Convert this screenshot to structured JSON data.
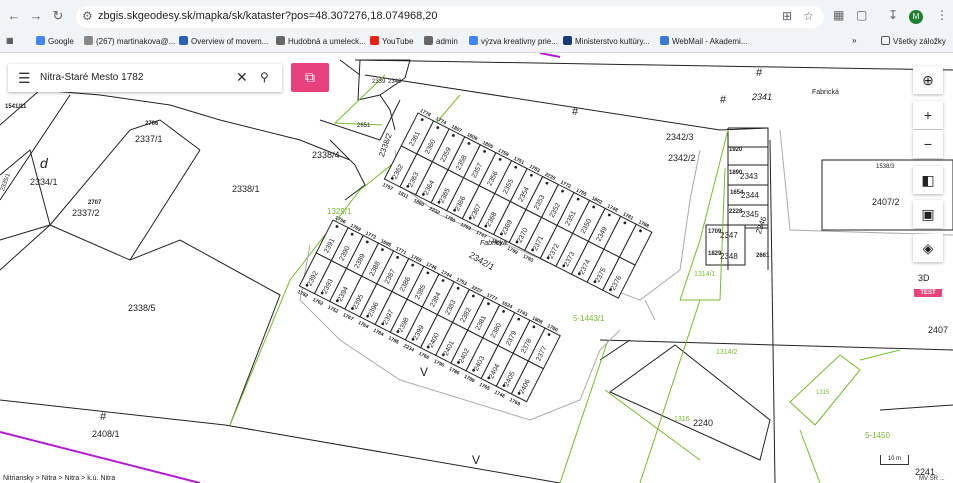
{
  "browser": {
    "url": "zbgis.skgeodesy.sk/mapka/sk/kataster?pos=48.307276,18.074968,20",
    "avatar_letter": "M",
    "bookmarks": [
      "Google",
      "(267) martinakova@...",
      "Overview of movem...",
      "Hudobná a umeleck...",
      "YouTube",
      "admin",
      "výzva kreativny prie...",
      "Ministerstvo kultúry...",
      "WebMail - Akademi..."
    ],
    "all_bookmarks": "Všetky záložky"
  },
  "search": {
    "query": "Nitra-Staré Mesto 1782"
  },
  "controls": {
    "label_3d": "3D",
    "test_badge": "TEST"
  },
  "footer": {
    "breadcrumb": "Nitriansky > Nitra > Nitra > k.ú. Nitra",
    "scale": "10 m",
    "attribution": "MV SR ..."
  },
  "map_labels": [
    {
      "text": "1541/11",
      "size": 6,
      "bold": true
    },
    {
      "text": "d",
      "size": 14,
      "italic": true
    },
    {
      "text": "2334/1",
      "size": 9
    },
    {
      "text": "2706",
      "size": 6,
      "bold": true
    },
    {
      "text": "2337/1",
      "size": 9
    },
    {
      "text": "2707",
      "size": 6,
      "bold": true
    },
    {
      "text": "2337/2",
      "size": 9
    },
    {
      "text": "2335/1",
      "size": 6
    },
    {
      "text": "2338/1",
      "size": 9
    },
    {
      "text": "2338/4",
      "size": 9
    },
    {
      "text": "2338/5",
      "size": 9
    },
    {
      "text": "2339",
      "size": 6
    },
    {
      "text": "2340",
      "size": 6
    },
    {
      "text": "2651",
      "size": 6
    },
    {
      "text": "2338/2",
      "size": 8
    },
    {
      "text": "2342/1",
      "size": 9
    },
    {
      "text": "Fabrická",
      "size": 7,
      "italic": true
    },
    {
      "text": "Fabrická",
      "size": 7
    },
    {
      "text": "2341",
      "size": 9,
      "italic": true
    },
    {
      "text": "2342/3",
      "size": 9
    },
    {
      "text": "2342/2",
      "size": 9
    },
    {
      "text": "1329/1",
      "size": 8,
      "green": true
    },
    {
      "text": "5-1443/1",
      "size": 8,
      "green": true
    },
    {
      "text": "1314/1",
      "size": 7,
      "green": true
    },
    {
      "text": "1314/2",
      "size": 7,
      "green": true
    },
    {
      "text": "1316",
      "size": 7,
      "green": true
    },
    {
      "text": "2240",
      "size": 9
    },
    {
      "text": "5-1450",
      "size": 8,
      "green": true
    },
    {
      "text": "2408/1",
      "size": 9
    },
    {
      "text": "2407/2",
      "size": 9
    },
    {
      "text": "2407",
      "size": 9
    },
    {
      "text": "1538/3",
      "size": 6
    },
    {
      "text": "1920",
      "size": 6,
      "bold": true
    },
    {
      "text": "2343",
      "size": 8
    },
    {
      "text": "1890",
      "size": 6,
      "bold": true
    },
    {
      "text": "1654",
      "size": 6,
      "bold": true
    },
    {
      "text": "2344",
      "size": 8
    },
    {
      "text": "2228",
      "size": 6,
      "bold": true
    },
    {
      "text": "2345",
      "size": 8
    },
    {
      "text": "1709",
      "size": 6,
      "bold": true
    },
    {
      "text": "2347",
      "size": 8
    },
    {
      "text": "1829",
      "size": 6,
      "bold": true
    },
    {
      "text": "2348",
      "size": 8
    },
    {
      "text": "2346",
      "size": 8
    },
    {
      "text": "2661",
      "size": 6,
      "bold": true
    },
    {
      "text": "1315",
      "size": 6,
      "green": true
    },
    {
      "text": "2241",
      "size": 9
    }
  ],
  "garage_row1": {
    "parcels": [
      "2361",
      "2360",
      "2359",
      "2358",
      "2357",
      "2356",
      "2355",
      "2354",
      "2353",
      "2352",
      "2351",
      "2350",
      "2349"
    ],
    "lower": [
      "2362",
      "2363",
      "2364",
      "2365",
      "2366",
      "2367",
      "2368",
      "2369",
      "2370",
      "2371",
      "2372",
      "2373",
      "2374",
      "2375",
      "2376"
    ],
    "owners": [
      "1778",
      "1774",
      "1807",
      "1809",
      "1805",
      "1759",
      "1751",
      "1783",
      "2230",
      "1772",
      "1755",
      "1802",
      "1748",
      "1761",
      "1788",
      "1757",
      "1811",
      "1860",
      "2232",
      "1780",
      "1793",
      "1747",
      "1801",
      "1799",
      "1793"
    ]
  },
  "garage_row2": {
    "parcels": [
      "2391",
      "2390",
      "2389",
      "2388",
      "2387",
      "2386",
      "2385",
      "2384",
      "2383",
      "2382",
      "2381",
      "2380",
      "2379",
      "2378",
      "2377"
    ],
    "lower": [
      "2392",
      "2393",
      "2394",
      "2395",
      "2396",
      "2397",
      "2398",
      "2399",
      "2400",
      "2401",
      "2402",
      "2403",
      "2404",
      "2405",
      "2406"
    ],
    "owners": [
      "1756",
      "1769",
      "1773",
      "1695",
      "1771",
      "1768",
      "1746",
      "1744",
      "1753",
      "2227",
      "1777",
      "1624",
      "1743",
      "1808",
      "1760",
      "1782",
      "1762",
      "1752",
      "1767",
      "1764",
      "1784",
      "1785",
      "2234",
      "1766",
      "1790",
      "1786",
      "1789",
      "1765",
      "1746",
      "1769"
    ]
  }
}
